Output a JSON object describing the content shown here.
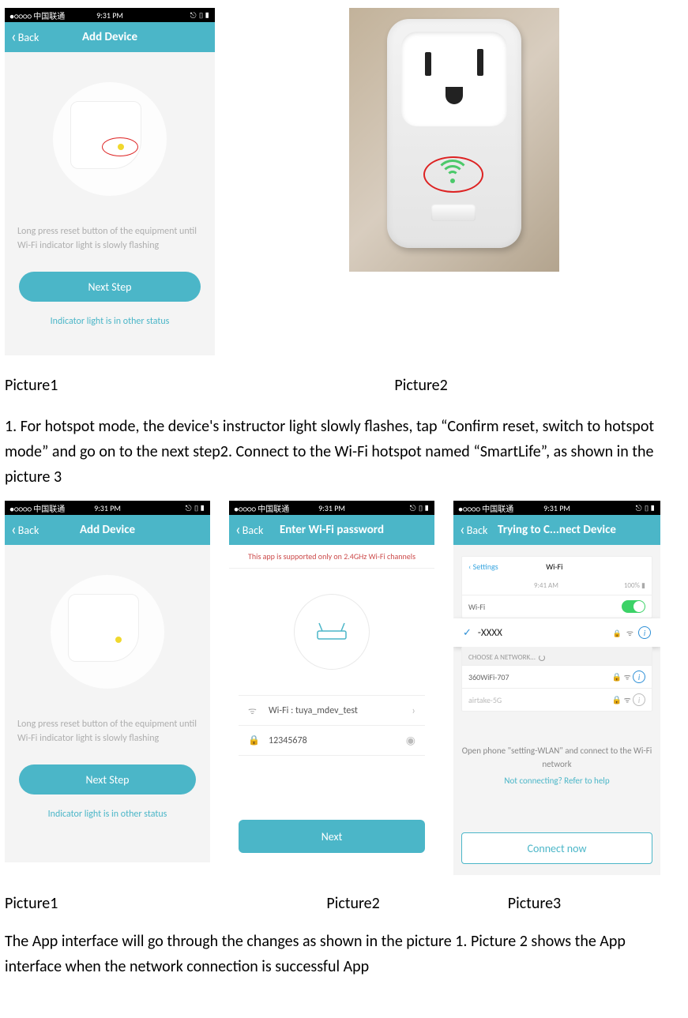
{
  "statusbar": {
    "carrier": "●○○○○ 中国联通",
    "wifi_icon": "ᯤ",
    "time": "9:31 PM",
    "right": "⎋ ▯▮"
  },
  "statusbar_p3_settings": {
    "time": "9:41 AM",
    "battery": "100% ▮"
  },
  "screen_add_device": {
    "back": "Back",
    "title": "Add Device",
    "instruction": "Long press reset button of the equipment until Wi-Fi indicator light is slowly flashing",
    "primary": "Next Step",
    "link": "Indicator light is in other status"
  },
  "screen_wifi": {
    "back": "Back",
    "title": "Enter Wi-Fi password",
    "banner": "This app is supported only on 2.4GHz Wi-Fi channels",
    "ssid_label": "Wi-Fi : tuya_mdev_test",
    "password": "12345678",
    "next": "Next"
  },
  "screen_connect": {
    "back": "Back",
    "title": "Trying to C...nect Device",
    "settings_back": "Settings",
    "settings_title": "Wi-Fi",
    "wifi_toggle_label": "Wi-Fi",
    "selected_network": "-XXXX",
    "choose_label": "CHOOSE A NETWORK...",
    "net1": "360WiFi-707",
    "net2": "airtake-5G",
    "hint": "Open phone \"setting-WLAN\" and connect to the Wi-Fi network",
    "hint_link": "Not connecting? Refer to help",
    "connect_btn": "Connect now"
  },
  "captions": {
    "p1": "Picture1",
    "p2": "Picture2",
    "p3": "Picture3"
  },
  "paragraph1": "1. For hotspot mode, the device's instructor light slowly flashes, tap “Confirm reset, switch to hotspot mode” and go on to the next step2. Connect to the Wi-Fi hotspot named “SmartLife”, as shown in the picture 3",
  "paragraph2": "The App interface will go through the changes as shown in the picture 1. Picture 2 shows the App interface when the network connection is successful App"
}
